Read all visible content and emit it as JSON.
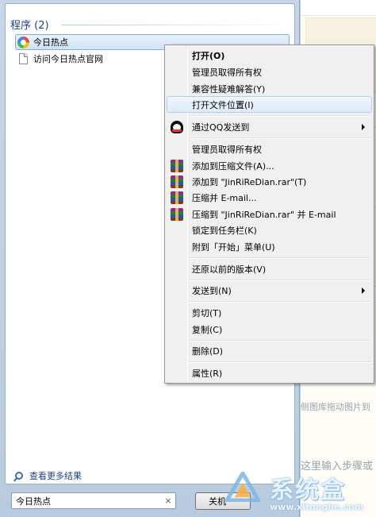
{
  "programs_group": {
    "header": "程序 (2)",
    "items": [
      {
        "label": "今日热点",
        "icon": "jinri-app-icon",
        "selected": true
      },
      {
        "label": "访问今日热点官网",
        "icon": "document-icon",
        "selected": false
      }
    ]
  },
  "see_more_results": "查看更多结果",
  "search": {
    "value": "今日热点",
    "clear": "×"
  },
  "shutdown_label": "关机",
  "context_menu": {
    "items": [
      {
        "id": "open",
        "label": "打开(O)",
        "bold": true
      },
      {
        "id": "take-ownership-1",
        "label": "管理员取得所有权"
      },
      {
        "id": "compat-troubleshoot",
        "label": "兼容性疑难解答(Y)"
      },
      {
        "id": "open-file-location",
        "label": "打开文件位置(I)",
        "hover": true
      },
      {
        "id": "send-via-qq",
        "label": "通过QQ发送到",
        "icon": "qq-icon",
        "submenu": true
      },
      {
        "id": "take-ownership-2",
        "label": "管理员取得所有权"
      },
      {
        "id": "add-to-archive",
        "label": "添加到压缩文件(A)...",
        "icon": "winrar-icon"
      },
      {
        "id": "add-to-rar",
        "label": "添加到 \"JinRiReDian.rar\"(T)",
        "icon": "winrar-icon"
      },
      {
        "id": "compress-email",
        "label": "压缩并 E-mail...",
        "icon": "winrar-icon"
      },
      {
        "id": "compress-rar-email",
        "label": "压缩到 \"JinRiReDian.rar\" 并 E-mail",
        "icon": "winrar-icon"
      },
      {
        "id": "pin-taskbar",
        "label": "锁定到任务栏(K)"
      },
      {
        "id": "pin-start",
        "label": "附到「开始」菜单(U)"
      },
      {
        "id": "restore-previous",
        "label": "还原以前的版本(V)"
      },
      {
        "id": "send-to",
        "label": "发送到(N)",
        "submenu": true
      },
      {
        "id": "cut",
        "label": "剪切(T)"
      },
      {
        "id": "copy",
        "label": "复制(C)"
      },
      {
        "id": "delete",
        "label": "删除(D)"
      },
      {
        "id": "properties",
        "label": "属性(R)"
      }
    ]
  },
  "background": {
    "text_drag_hint": "侧图库拖动图片到",
    "text_input_hint": "这里输入步骤或"
  },
  "watermark": {
    "brand": "系统盒",
    "url": "www.xitonghe.com"
  }
}
